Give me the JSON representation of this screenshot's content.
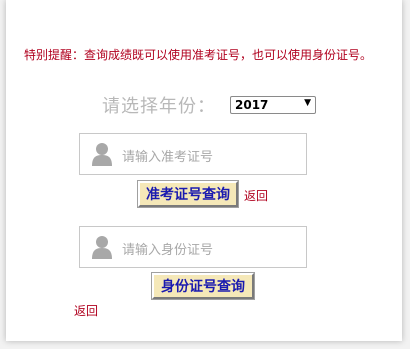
{
  "notice": "特别提醒：查询成绩既可以使用准考证号，也可以使用身份证号。",
  "year": {
    "label": "请选择年份：",
    "selected": "2017"
  },
  "exam_search": {
    "placeholder": "请输入准考证号",
    "button_label": "准考证号查询",
    "back_label": "返回"
  },
  "id_search": {
    "placeholder": "请输入身份证号",
    "button_label": "身份证号查询",
    "back_label": "返回"
  },
  "colors": {
    "notice_red": "#b0001e",
    "button_bg": "#f5e8b8",
    "button_text": "#1a1ab0"
  },
  "icons": {
    "year_dropdown": "dropdown-arrow-icon",
    "input_user": "user-icon"
  }
}
